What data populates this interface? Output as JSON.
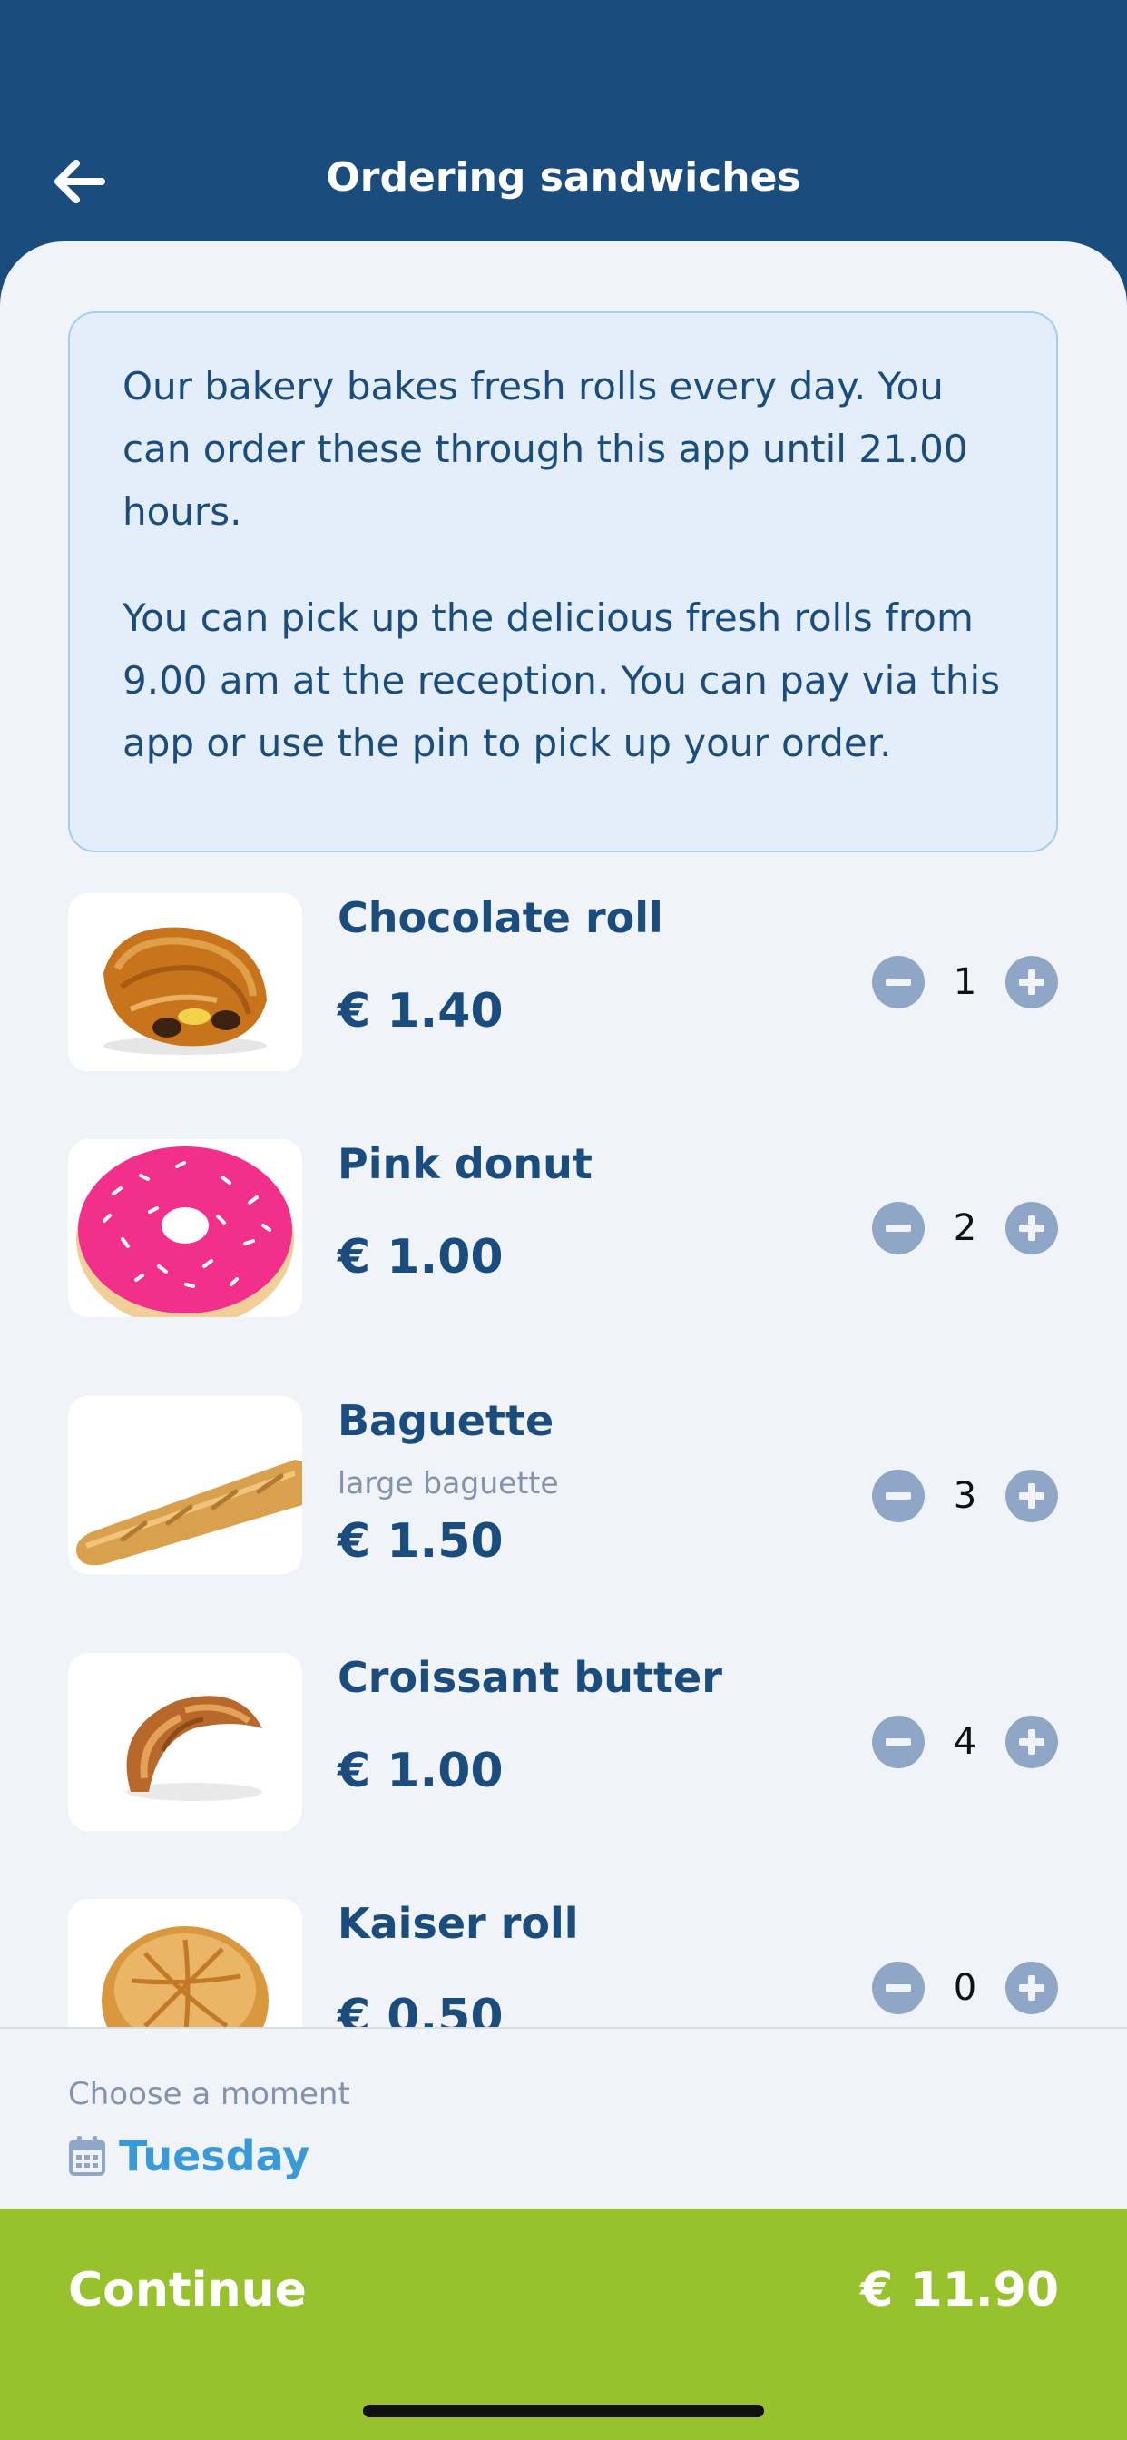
{
  "header": {
    "title": "Ordering sandwiches",
    "back_icon": "arrow-left-icon"
  },
  "info": {
    "paragraph1": "Our bakery bakes fresh rolls every day. You can order these through this app until 21.00 hours.",
    "paragraph2": "You can pick up the delicious fresh rolls from 9.00 am at the reception. You can pay via this app or use the pin to pick up your order."
  },
  "products": [
    {
      "name": "Chocolate roll",
      "description": "",
      "price": "€ 1.40",
      "quantity": "1",
      "image": "chocolate-roll-image"
    },
    {
      "name": "Pink donut",
      "description": "",
      "price": "€ 1.00",
      "quantity": "2",
      "image": "pink-donut-image"
    },
    {
      "name": "Baguette",
      "description": "large baguette",
      "price": "€ 1.50",
      "quantity": "3",
      "image": "baguette-image"
    },
    {
      "name": "Croissant butter",
      "description": "",
      "price": "€ 1.00",
      "quantity": "4",
      "image": "croissant-image"
    },
    {
      "name": "Kaiser roll",
      "description": "",
      "price": "€ 0.50",
      "quantity": "0",
      "image": "kaiser-roll-image"
    }
  ],
  "moment": {
    "label": "Choose a moment",
    "value": "Tuesday",
    "icon": "calendar-icon"
  },
  "checkout": {
    "continue_label": "Continue",
    "total": "€ 11.90"
  },
  "colors": {
    "brand": "#1a4c7e",
    "accent": "#3a9ad9",
    "continue": "#97c22e",
    "background": "#f0f3f7"
  }
}
